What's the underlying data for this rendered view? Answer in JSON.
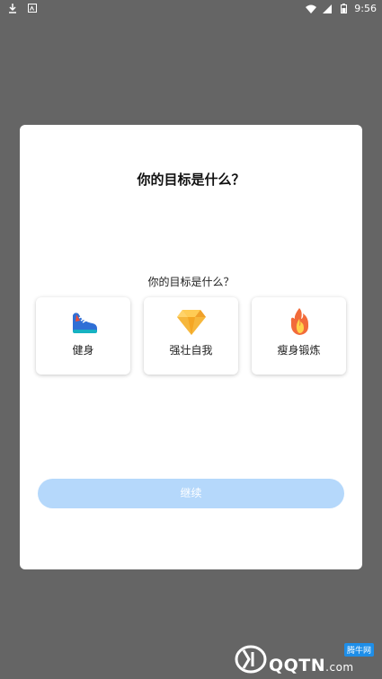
{
  "statusbar": {
    "time": "9:56",
    "icons": [
      "download-icon",
      "notification-icon",
      "wifi-icon",
      "signal-icon",
      "battery-icon"
    ]
  },
  "dialog": {
    "title": "你的目标是什么？",
    "question": "你的目标是什么？",
    "options": [
      {
        "label": "健身",
        "icon": "running-shoe-icon"
      },
      {
        "label": "强壮自我",
        "icon": "diamond-icon"
      },
      {
        "label": "瘦身锻炼",
        "icon": "flame-icon"
      }
    ],
    "continue_label": "继续",
    "continue_color": "#b5d8fb"
  },
  "watermark": {
    "badge": "腾牛网",
    "text_main": "QQTN",
    "text_suffix": ".com"
  }
}
